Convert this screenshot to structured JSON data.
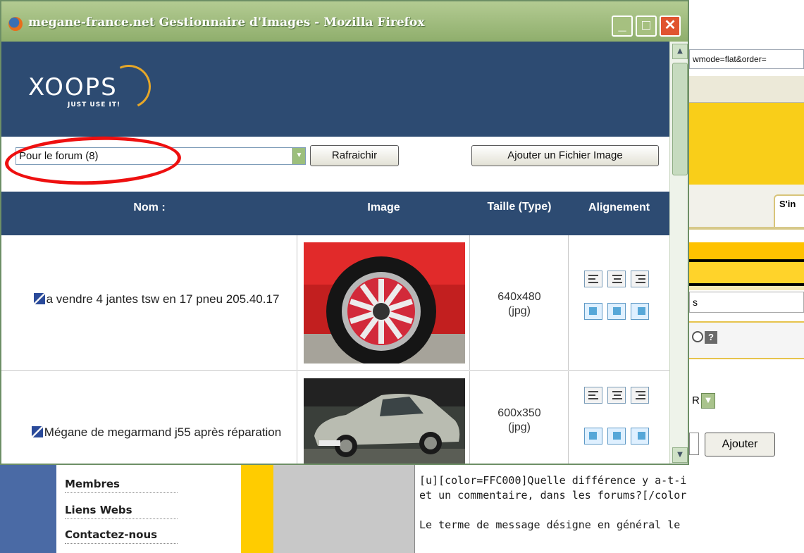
{
  "window": {
    "title": "megane-france.net Gestionnaire d'Images - Mozilla Firefox",
    "buttons": {
      "minimize": "_",
      "maximize": "□",
      "close": "✕"
    }
  },
  "logo": {
    "main": "XOOPS",
    "tagline": "JUST USE IT!"
  },
  "controls": {
    "category_select": "Pour le forum (8)",
    "refresh_label": "Rafraichir",
    "add_image_label": "Ajouter un Fichier Image"
  },
  "table": {
    "headers": {
      "name": "Nom :",
      "image": "Image",
      "size": "Taille (Type)",
      "alignment": "Alignement"
    },
    "rows": [
      {
        "name": "a vendre 4 jantes tsw en 17 pneu 205.40.17",
        "size": "640x480",
        "type": "(jpg)",
        "image_icon": "red-wheel-photo"
      },
      {
        "name": "Mégane de megarmand j55 après réparation",
        "size": "600x350",
        "type": "(jpg)",
        "image_icon": "silver-car-photo"
      }
    ]
  },
  "background": {
    "url_fragment": "wmode=flat&order=",
    "tab_label": "S'in",
    "field_text": "s",
    "select_text": "R",
    "add_button": "Ajouter",
    "menu": [
      "Membres",
      "Liens Webs",
      "Contactez-nous"
    ],
    "textarea_lines": [
      "[u][color=FFC000]Quelle différence y a-t-i",
      "et un commentaire, dans les forums?[/color",
      "",
      "Le terme de message désigne en général le"
    ]
  },
  "colors": {
    "header_blue": "#2d4b72",
    "accent_yellow": "#ffcc00",
    "highlight_red": "#ee1010",
    "titlebar_green": "#8fae6c"
  }
}
